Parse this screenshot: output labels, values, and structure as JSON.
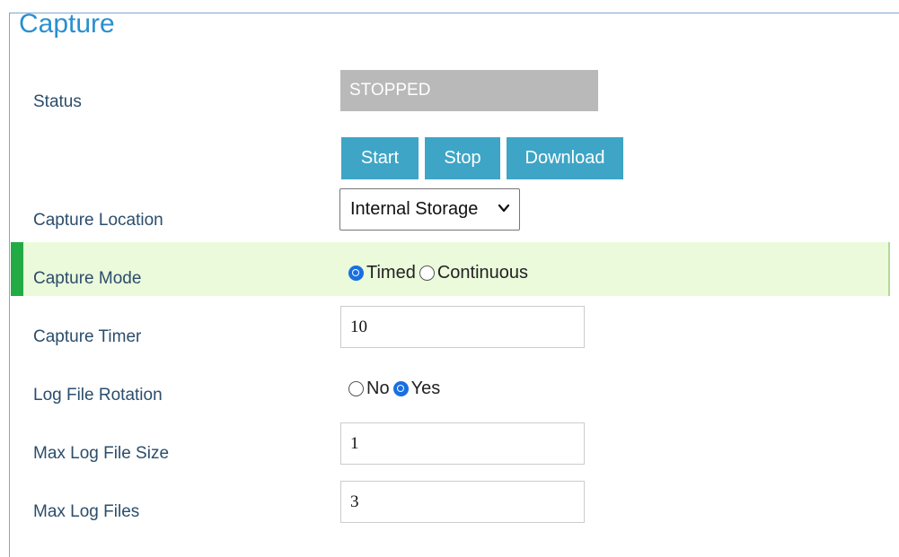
{
  "page": {
    "title": "Capture"
  },
  "status": {
    "label": "Status",
    "value": "STOPPED"
  },
  "actions": {
    "start_label": "Start",
    "stop_label": "Stop",
    "download_label": "Download"
  },
  "capture_location": {
    "label": "Capture Location",
    "selected": "Internal Storage"
  },
  "capture_mode": {
    "label": "Capture Mode",
    "options": [
      "Timed",
      "Continuous"
    ],
    "selected": "Timed"
  },
  "capture_timer": {
    "label": "Capture Timer",
    "value": "10"
  },
  "log_file_rotation": {
    "label": "Log File Rotation",
    "options": [
      "No",
      "Yes"
    ],
    "selected": "Yes"
  },
  "max_log_file_size": {
    "label": "Max Log File Size",
    "value": "1"
  },
  "max_log_files": {
    "label": "Max Log Files",
    "value": "3"
  },
  "colors": {
    "title": "#2a8fd0",
    "label": "#2b4d6b",
    "button": "#3ea5c6",
    "status_bg": "#b9b9b9",
    "highlight_bg": "#eafadb",
    "highlight_bar": "#22aa44",
    "radio_checked": "#1a6fe0"
  }
}
